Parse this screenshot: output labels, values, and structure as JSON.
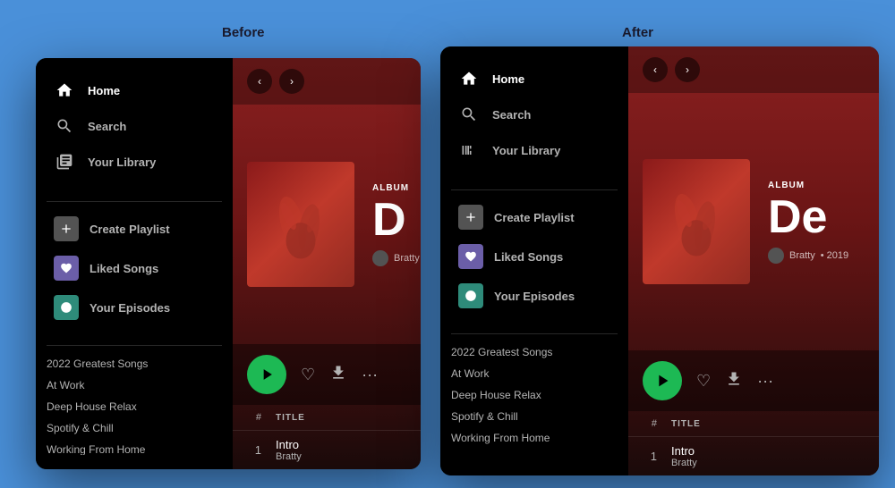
{
  "page": {
    "background": "#4A90D9",
    "before_label": "Before",
    "after_label": "After"
  },
  "sidebar": {
    "nav": [
      {
        "id": "home",
        "label": "Home",
        "icon": "home"
      },
      {
        "id": "search",
        "label": "Search",
        "icon": "search"
      },
      {
        "id": "library",
        "label": "Your Library",
        "icon": "library"
      }
    ],
    "library_items": [
      {
        "id": "create",
        "label": "Create Playlist",
        "icon": "+",
        "color": "gray"
      },
      {
        "id": "liked",
        "label": "Liked Songs",
        "icon": "♥",
        "color": "purple"
      },
      {
        "id": "episodes",
        "label": "Your Episodes",
        "icon": "●",
        "color": "teal"
      }
    ],
    "playlists": [
      "2022 Greatest Songs",
      "At Work",
      "Deep House Relax",
      "Spotify & Chill",
      "Working From Home"
    ]
  },
  "album": {
    "tag": "ALBUM",
    "title_short": "D",
    "title_full": "De",
    "artist": "Bratty",
    "year": "2019",
    "back_label": "‹",
    "forward_label": "›"
  },
  "tracklist": {
    "header_num": "#",
    "header_title": "TITLE",
    "tracks": [
      {
        "number": "1",
        "name": "Intro",
        "artist": "Bratty"
      }
    ]
  },
  "controls": {
    "play": "▶",
    "heart": "♡",
    "download": "⊙",
    "more": "···"
  }
}
